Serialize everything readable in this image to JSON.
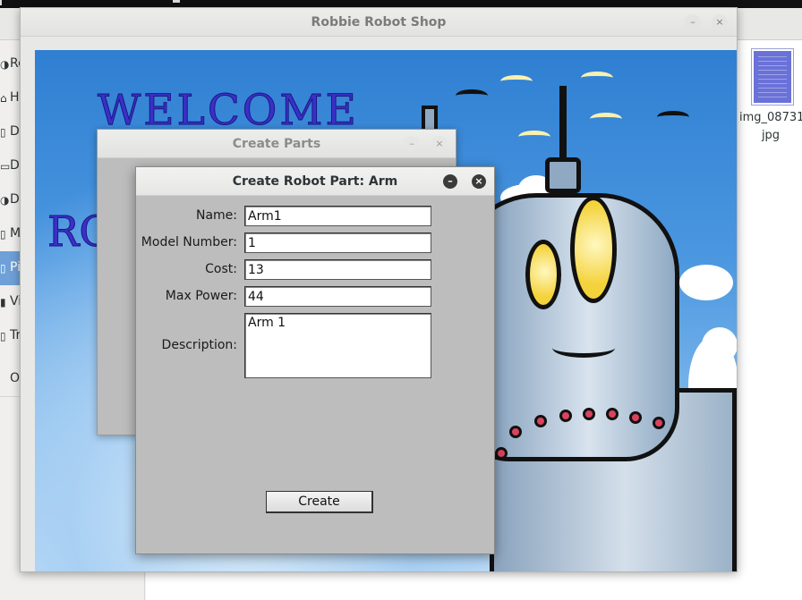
{
  "file_manager": {
    "sidebar_items": [
      {
        "icon": "◑",
        "label": "Re"
      },
      {
        "icon": "⌂",
        "label": "H"
      },
      {
        "icon": "▯",
        "label": "D"
      },
      {
        "icon": "▭",
        "label": "D"
      },
      {
        "icon": "◑",
        "label": "D"
      },
      {
        "icon": "▯",
        "label": "M"
      },
      {
        "icon": "▯",
        "label": "Pi"
      },
      {
        "icon": "▮",
        "label": "Vi"
      },
      {
        "icon": "▯",
        "label": "Tr"
      },
      {
        "icon": "",
        "label": "O"
      }
    ],
    "file": {
      "name": "img_08731\njpg"
    }
  },
  "main_window": {
    "title": "Robbie Robot Shop",
    "welcome_text": "WELCOME",
    "ro_text": "RO",
    "minimize_symbol": "–",
    "close_symbol": "×"
  },
  "parts_window": {
    "title": "Create Parts",
    "minimize_symbol": "–",
    "close_symbol": "×"
  },
  "dialog": {
    "title": "Create Robot Part: Arm",
    "minimize_symbol": "–",
    "close_symbol": "×",
    "fields": {
      "name": {
        "label": "Name:",
        "value": "Arm1"
      },
      "model_number": {
        "label": "Model Number:",
        "value": "1"
      },
      "cost": {
        "label": "Cost:",
        "value": "13"
      },
      "max_power": {
        "label": "Max Power:",
        "value": "44"
      },
      "description": {
        "label": "Description:",
        "value": "Arm 1"
      }
    },
    "create_label": "Create"
  }
}
